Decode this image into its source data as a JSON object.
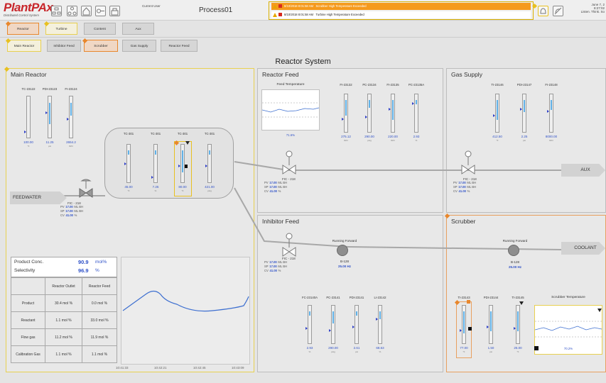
{
  "header": {
    "logo_main": "PlantPAx",
    "logo_sub": "Distributed Control System",
    "current_user_label": "Current User",
    "process_name": "Process01",
    "date": "June 7, 2",
    "time": "8:27:02",
    "slogan": "Listen. Think. So"
  },
  "alarms": [
    {
      "timestamp": "8/10/2018 8:01:58 AM",
      "message": "Scrubber High Temperature Exceeded"
    },
    {
      "timestamp": "8/10/2018 8:01:58 AM",
      "message": "Turbine High Temperature Exceeded"
    }
  ],
  "nav": {
    "row1": [
      "Reactor",
      "Turbine",
      "Content",
      "Aux"
    ],
    "row2": [
      "Main Reactor",
      "Inhibitor Feed",
      "Scrubber",
      "Gas Supply",
      "Reactor Feed"
    ]
  },
  "page_title": "Reactor System",
  "panels": {
    "main": "Main Reactor",
    "reactor_feed": "Reactor Feed",
    "gas_supply": "Gas Supply",
    "inhibitor_feed": "Inhibitor Feed",
    "scrubber": "Scrubber"
  },
  "main_gauges": [
    {
      "tag": "TC-23122",
      "value": "100.00",
      "unit": "°F"
    },
    {
      "tag": "PDI-23123",
      "value": "11.25",
      "unit": "psi"
    },
    {
      "tag": "FI-23124",
      "value": "2654.2",
      "unit": "lb/hr"
    }
  ],
  "vessel_gauges": [
    {
      "tag": "TC-301",
      "value": "45.00",
      "unit": "°F"
    },
    {
      "tag": "TC-301",
      "value": "7.25",
      "unit": "%"
    },
    {
      "tag": "TC-301",
      "value": "80.00",
      "unit": "°F"
    },
    {
      "tag": "TC-301",
      "value": "421.00",
      "unit": "psig"
    }
  ],
  "feedwater": "FEEDWATER",
  "aux": "AUX",
  "coolant": "COOLANT",
  "controller": {
    "tag": "FIC - 218",
    "pv_label": "PV",
    "sp_label": "SP",
    "cv_label": "CV",
    "pv": "17.00",
    "sp": "17.00",
    "cv": "41.00",
    "pv_unit": "ML BH",
    "sp_unit": "ML BH",
    "cv_unit": "%"
  },
  "reactor_feed": {
    "chart_title": "Feed Temperature",
    "chart_value": "71.6%",
    "gauges": [
      {
        "tag": "FI-23132",
        "value": "275.12",
        "unit": "lb/hr"
      },
      {
        "tag": "PC-23134",
        "value": "290.00",
        "unit": "psig"
      },
      {
        "tag": "FI-23135",
        "value": "220.00",
        "unit": "lb/hr"
      },
      {
        "tag": "PC-23135A",
        "value": "2.93",
        "unit": "%"
      }
    ]
  },
  "gas_supply": {
    "gauges": [
      {
        "tag": "TI-23146",
        "value": "412.50",
        "unit": "°F"
      },
      {
        "tag": "PDI-23147",
        "value": "2.25",
        "unit": "psi"
      },
      {
        "tag": "FI-23148",
        "value": "8000.00",
        "unit": "lb/hr"
      }
    ]
  },
  "inhibitor": {
    "pump_status": "Running Forward",
    "pump_tag": "B-128",
    "pump_value": "25.00",
    "pump_unit": "Hz",
    "gauges": [
      {
        "tag": "FC-23140A",
        "value": "2.93",
        "unit": "%"
      },
      {
        "tag": "PC-23141",
        "value": "290.00",
        "unit": "psig"
      },
      {
        "tag": "PDI-23141",
        "value": "2.61",
        "unit": "psi"
      },
      {
        "tag": "LI-23142",
        "value": "68.63",
        "unit": "%"
      }
    ]
  },
  "scrubber": {
    "pump_status": "Running Forward",
    "pump_tag": "B-128",
    "pump_value": "25.00",
    "pump_unit": "Hz",
    "chart_title": "Scrubber Temperature",
    "chart_value": "70.2%",
    "gauges": [
      {
        "tag": "TI-23143",
        "value": "77.00",
        "unit": "°F"
      },
      {
        "tag": "PDI-23144",
        "value": "1.50",
        "unit": "psi"
      },
      {
        "tag": "TI-23145",
        "value": "25.00",
        "unit": "°F"
      }
    ]
  },
  "product": {
    "conc_label": "Product Conc.",
    "conc_value": "90.9",
    "conc_unit": "mol%",
    "sel_label": "Selectivity",
    "sel_value": "96.9",
    "sel_unit": "%",
    "col1": "Reactor Outlet",
    "col2": "Reactor Feed",
    "rows": [
      {
        "name": "Product",
        "outlet": "30.4 mol %",
        "feed": "0.0 mol %"
      },
      {
        "name": "Reactant",
        "outlet": "1.1 mol %",
        "feed": "33.0 mol %"
      },
      {
        "name": "Flow gas",
        "outlet": "11.2 mol %",
        "feed": "11.9 mol %"
      },
      {
        "name": "Calibration Gas",
        "outlet": "1.1 mol %",
        "feed": "1.1 mol %"
      }
    ]
  },
  "trend_times": [
    "10:41:33",
    "10:42:21",
    "10:42:45",
    "10:43:09"
  ],
  "colors": {
    "accent": "#e8872c",
    "warning": "#e8c020",
    "value": "#3052c8",
    "alarm": "#f59a1c"
  }
}
